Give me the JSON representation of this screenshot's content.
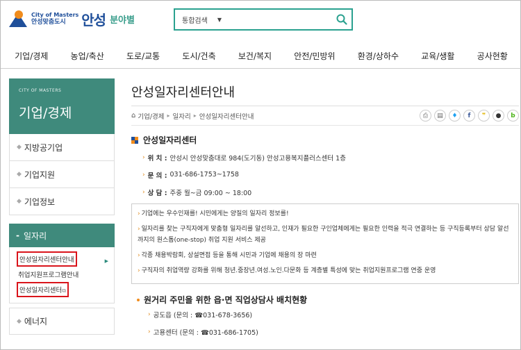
{
  "header": {
    "logo_small_top": "City of Masters",
    "logo_small_bottom": "안성맞춤도시",
    "logo_big": "안성",
    "logo_sub": "분야별",
    "search": {
      "scope": "통합검색",
      "value": "",
      "placeholder": ""
    }
  },
  "gnb": [
    "기업/경제",
    "농업/축산",
    "도로/교통",
    "도시/건축",
    "보건/복지",
    "안전/민방위",
    "환경/상하수",
    "교육/생활",
    "공사현황"
  ],
  "sidebar": {
    "head_en": "CITY OF MASTERS",
    "head_ko": "기업/경제",
    "items_top": [
      "지방공기업",
      "기업지원",
      "기업정보"
    ],
    "active": "일자리",
    "sub_items": [
      "안성일자리센터안내",
      "취업지원프로그램안내",
      "안성일자리센터"
    ],
    "items_bottom": [
      "에너지"
    ]
  },
  "main": {
    "title": "안성일자리센터안내",
    "breadcrumb": [
      "기업/경제",
      "일자리",
      "안성일자리센터안내"
    ],
    "section1": {
      "title": "안성일자리센터",
      "location_label": "위 치 :",
      "location": "안성시 안성맞춤대로 984(도기동) 안성고용복지플러스센터 1층",
      "phone_label": "문 의 :",
      "phone": "031-686-1753~1758",
      "hours_label": "상 담 :",
      "hours": "주중 월~금 09:00 ~ 18:00"
    },
    "box": [
      "기업에는 우수인재를! 시민에게는 양질의 일자리 정보를!",
      "일자리를 찾는 구직자에게 맞춤형 일자리를 알선하고, 인재가 필요한 구인업체에게는 필요한 인력을 적극 연결하는 등 구직등록부터 상담 알선까지의 원스톱(one-stop) 취업 지원 서비스 제공",
      "각종 채용박람회, 상설면접 등을 통해 시민과 기업에 채용의 장 마련",
      "구직자의 취업역량 강화를 위해 청년.중장년.여성.노인.다문화 등 계층별 특성에 맞는 취업지원프로그램 연중 운영"
    ],
    "section2": {
      "title": "원거리 주민을 위한 읍·면 직업상담사 배치현황",
      "rows": [
        "공도읍 (문의 : ☎031-678-3656)",
        "고용센터 (문의 : ☎031-686-1705)"
      ]
    }
  },
  "colors": {
    "accent": "#3f8a7c",
    "search_border": "#2aa18f",
    "highlight_red": "#d9141b",
    "logo_blue": "#1f4f9a"
  }
}
